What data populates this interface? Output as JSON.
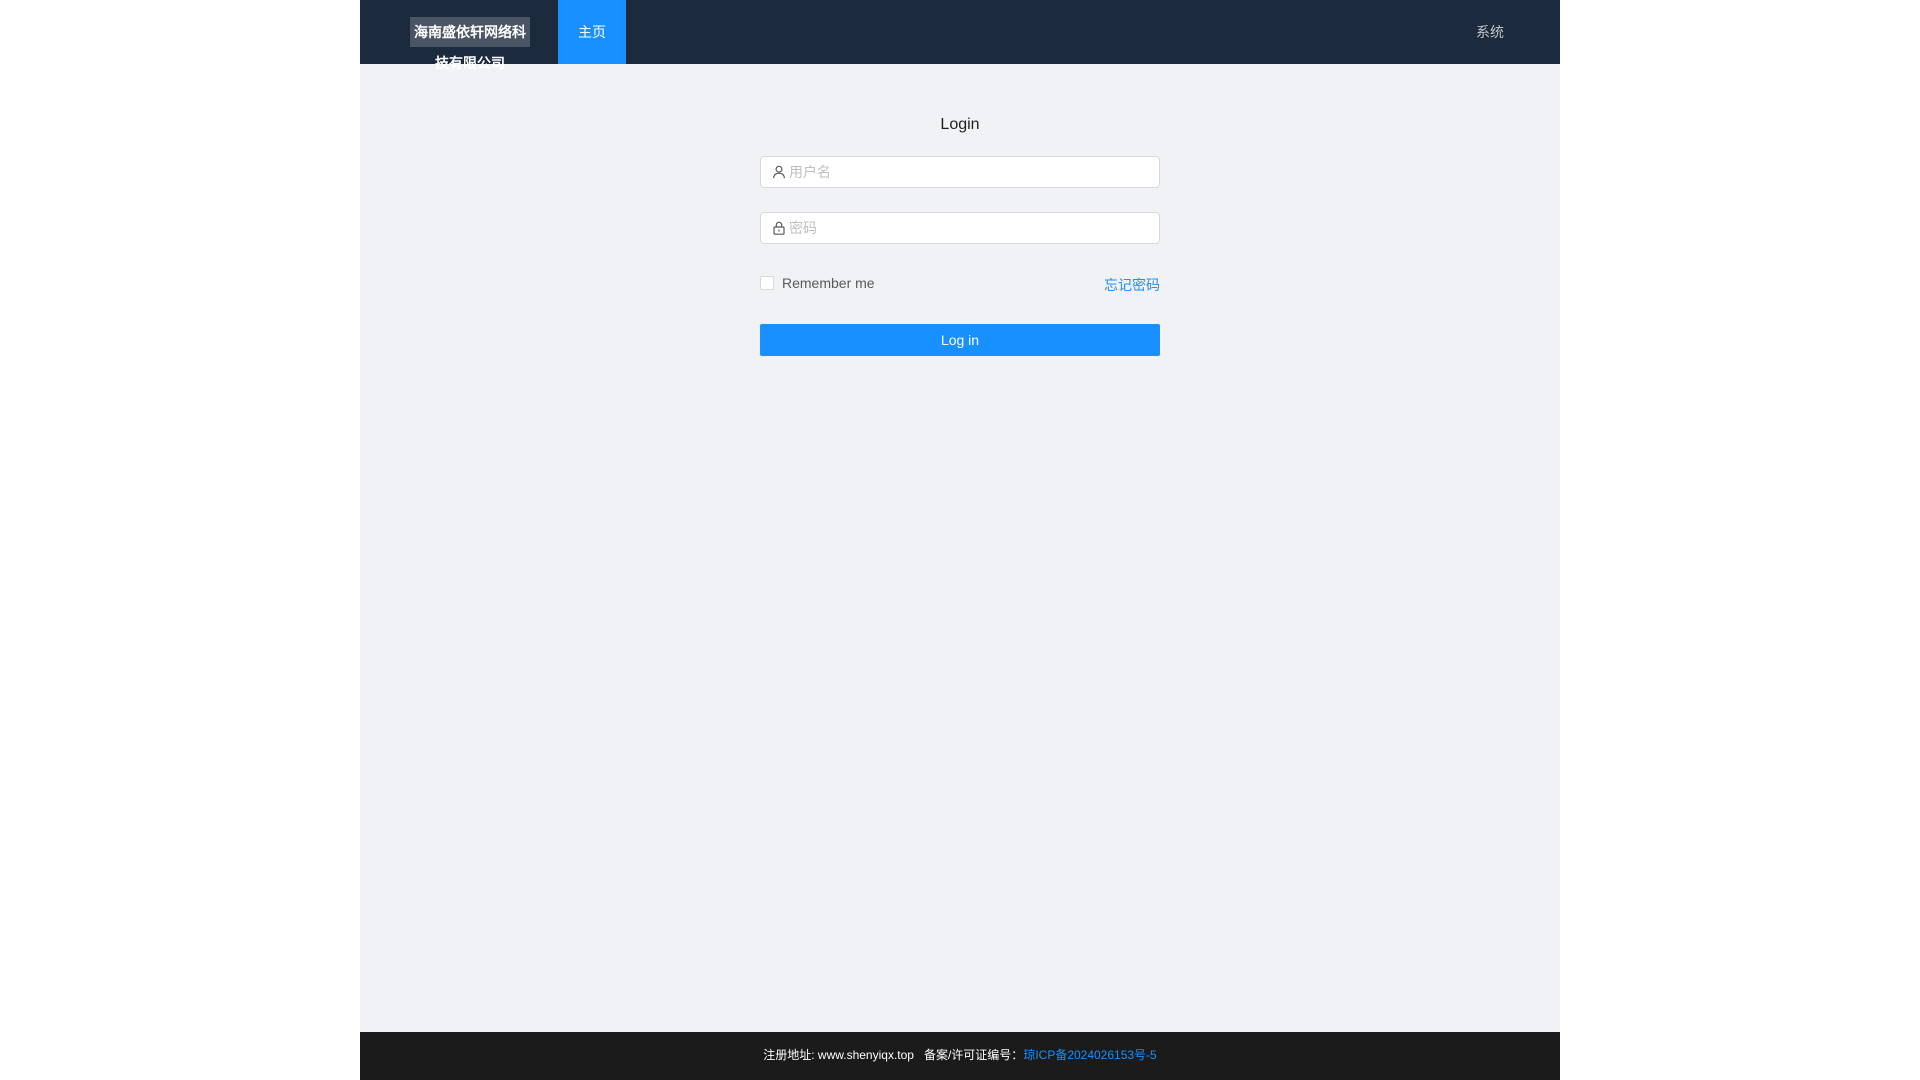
{
  "header": {
    "company_name": "海南盛依轩网络科技有限公司",
    "nav_home": "主页",
    "nav_system": "系统"
  },
  "login": {
    "title": "Login",
    "username_placeholder": "用户名",
    "password_placeholder": "密码",
    "remember_label": "Remember me",
    "forgot_password": "忘记密码",
    "submit_label": "Log in"
  },
  "footer": {
    "address_text": "注册地址: www.shenyiqx.top",
    "license_prefix": "备案/许可证编号：",
    "license_number": "琼ICP备2024026153号-5"
  },
  "colors": {
    "header_bg": "#1b2a3c",
    "accent": "#1890ff",
    "page_bg": "#f0f2f5",
    "footer_bg": "#1b1b1b"
  },
  "icons": {
    "username": "user-icon",
    "password": "lock-icon"
  }
}
